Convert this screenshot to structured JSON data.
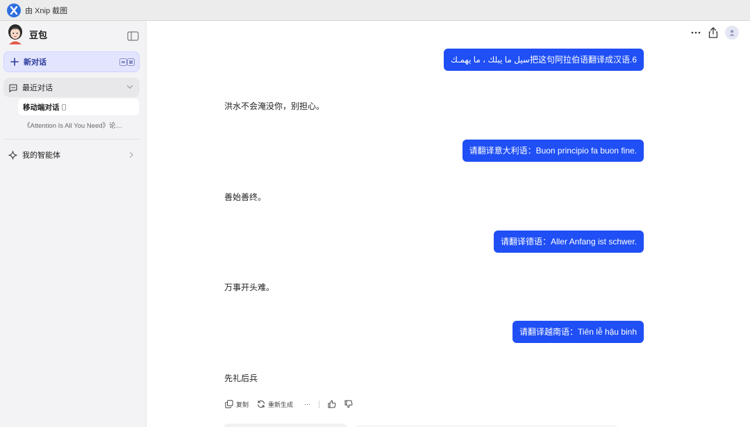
{
  "titlebar": {
    "text": "由 Xnip 截图"
  },
  "sidebar": {
    "brand_name": "豆包",
    "new_chat_label": "新对话",
    "recent_label": "最近对话",
    "conversations": [
      {
        "label": "移动端对话",
        "active": true
      },
      {
        "label": "《Attention Is All You Need》论…",
        "active": false
      }
    ],
    "agents_label": "我的智能体"
  },
  "chat": {
    "messages": [
      {
        "role": "user",
        "text": "6.把这句阿拉伯语翻译成汉语سيل ما يبلك ، ما يهمـك"
      },
      {
        "role": "assistant",
        "text": "洪水不会淹没你，别担心。"
      },
      {
        "role": "user",
        "text": "请翻译意大利语：Buon principio fa buon fine."
      },
      {
        "role": "assistant",
        "text": "善始善终。"
      },
      {
        "role": "user",
        "text": "请翻译德语：Aller Anfang ist schwer."
      },
      {
        "role": "assistant",
        "text": "万事开头难。"
      },
      {
        "role": "user",
        "text": "请翻译越南语：Tiên lễ hậu binh"
      },
      {
        "role": "assistant",
        "text": "先礼后兵"
      }
    ],
    "actions": {
      "copy_label": "复制",
      "regenerate_label": "重新生成",
      "more_label": "···"
    }
  },
  "colors": {
    "accent": "#1f4ff5",
    "sidebar_bg": "#f3f3f5",
    "new_chat_bg": "#e3e5ff"
  }
}
